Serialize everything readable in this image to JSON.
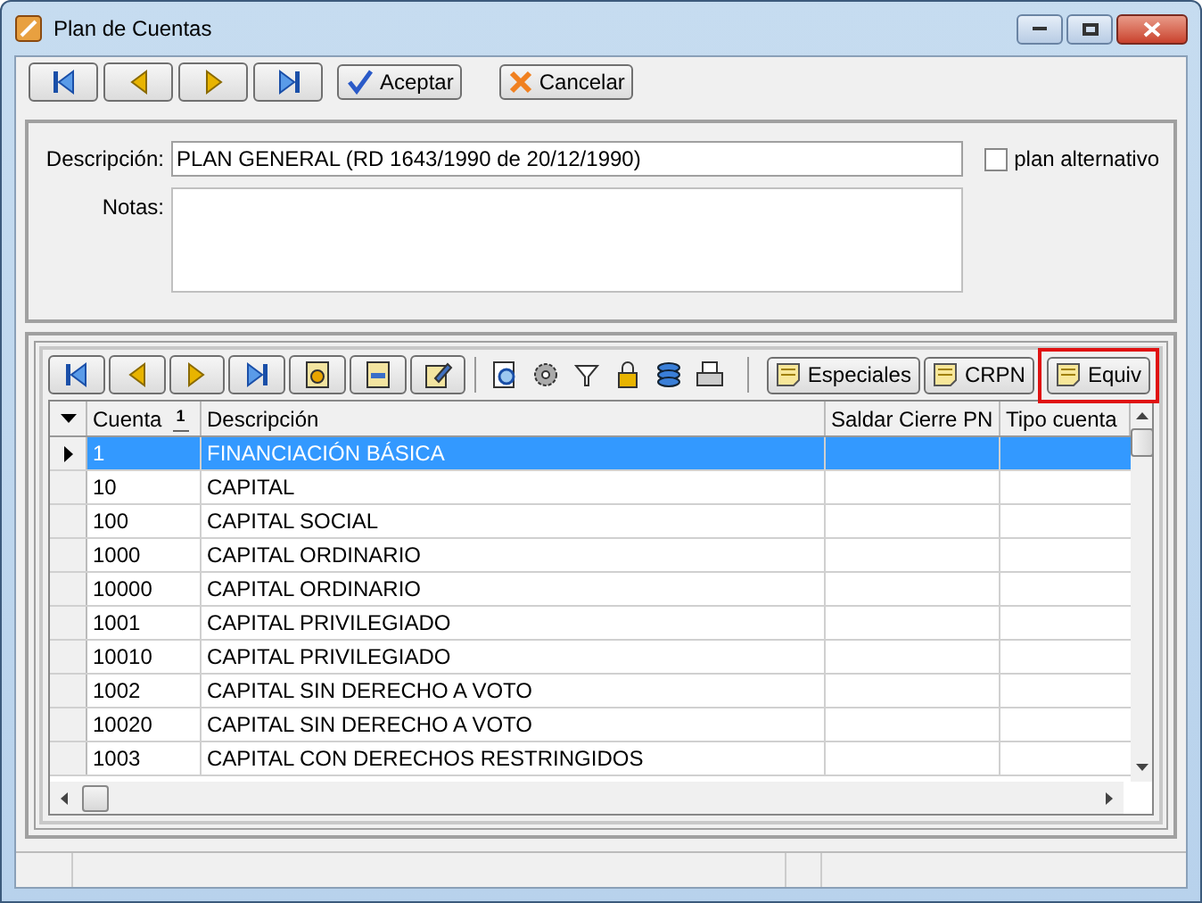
{
  "window": {
    "title": "Plan de Cuentas"
  },
  "toolbar": {
    "buttons": [
      {
        "kind": "first"
      },
      {
        "kind": "prev"
      },
      {
        "kind": "next"
      },
      {
        "kind": "last"
      }
    ],
    "accept": "Aceptar",
    "cancel": "Cancelar"
  },
  "form": {
    "description_label": "Descripción:",
    "description_value": "PLAN GENERAL (RD 1643/1990 de 20/12/1990)",
    "alternative": {
      "label": "plan alternativo",
      "checked": false
    },
    "notes_label": "Notas:"
  },
  "grid_toolbar": {
    "buttons": [
      {
        "kind": "first"
      },
      {
        "kind": "prev"
      },
      {
        "kind": "next"
      },
      {
        "kind": "last"
      },
      {
        "kind": "add"
      },
      {
        "kind": "delete"
      },
      {
        "kind": "edit"
      }
    ],
    "tools": [
      {
        "kind": "search"
      },
      {
        "kind": "gear"
      },
      {
        "kind": "filter"
      },
      {
        "kind": "lock"
      },
      {
        "kind": "stack"
      },
      {
        "kind": "print"
      }
    ],
    "text_buttons": [
      {
        "label": "Especiales",
        "highlighted": false
      },
      {
        "label": "CRPN",
        "highlighted": false
      },
      {
        "label": "Equiv",
        "highlighted": true
      }
    ]
  },
  "table": {
    "columns": [
      {
        "label": "Cuenta",
        "sort_index": "1"
      },
      {
        "label": "Descripción"
      },
      {
        "label": "Saldar Cierre PN"
      },
      {
        "label": "Tipo cuenta"
      }
    ],
    "rows": [
      {
        "cuenta": "1",
        "descripcion": "FINANCIACIÓN BÁSICA",
        "selected": true
      },
      {
        "cuenta": "10",
        "descripcion": "CAPITAL",
        "selected": false
      },
      {
        "cuenta": "100",
        "descripcion": "CAPITAL SOCIAL",
        "selected": false
      },
      {
        "cuenta": "1000",
        "descripcion": "CAPITAL ORDINARIO",
        "selected": false
      },
      {
        "cuenta": "10000",
        "descripcion": "CAPITAL ORDINARIO",
        "selected": false
      },
      {
        "cuenta": "1001",
        "descripcion": "CAPITAL PRIVILEGIADO",
        "selected": false
      },
      {
        "cuenta": "10010",
        "descripcion": "CAPITAL PRIVILEGIADO",
        "selected": false
      },
      {
        "cuenta": "1002",
        "descripcion": "CAPITAL SIN DERECHO A VOTO",
        "selected": false
      },
      {
        "cuenta": "10020",
        "descripcion": "CAPITAL SIN DERECHO A VOTO",
        "selected": false
      },
      {
        "cuenta": "1003",
        "descripcion": "CAPITAL CON DERECHOS RESTRINGIDOS",
        "selected": false
      }
    ]
  }
}
